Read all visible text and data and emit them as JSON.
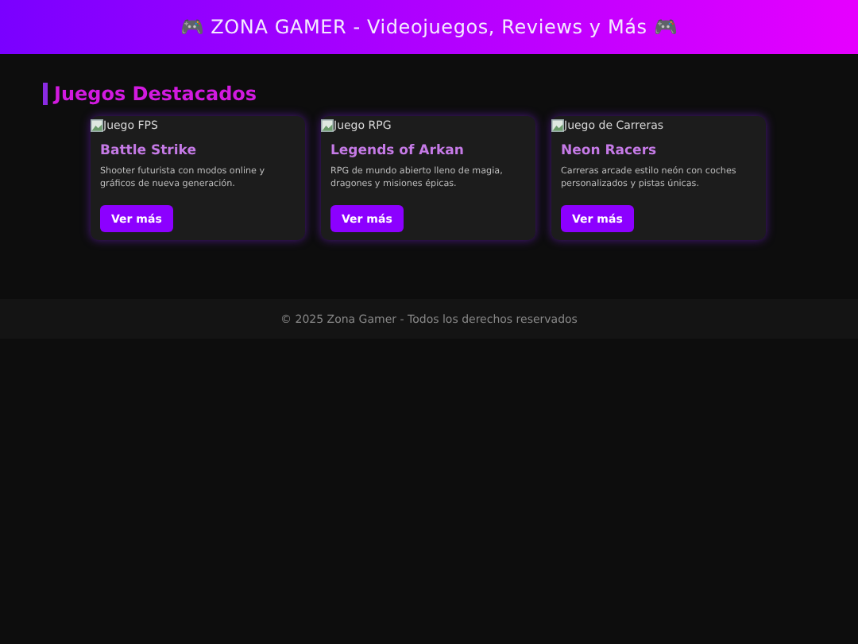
{
  "header": {
    "title": "🎮 ZONA GAMER - Videojuegos, Reviews y Más 🎮"
  },
  "section": {
    "heading": "Juegos Destacados",
    "cards": [
      {
        "image_alt": "Juego FPS",
        "title": "Battle Strike",
        "description": "Shooter futurista con modos online y gráficos de nueva generación.",
        "button": "Ver más"
      },
      {
        "image_alt": "Juego RPG",
        "title": "Legends of Arkan",
        "description": "RPG de mundo abierto lleno de magia, dragones y misiones épicas.",
        "button": "Ver más"
      },
      {
        "image_alt": "Juego de Carreras",
        "title": "Neon Racers",
        "description": "Carreras arcade estilo neón con coches personalizados y pistas únicas.",
        "button": "Ver más"
      }
    ]
  },
  "footer": {
    "text": "© 2025 Zona Gamer - Todos los derechos reservados"
  }
}
